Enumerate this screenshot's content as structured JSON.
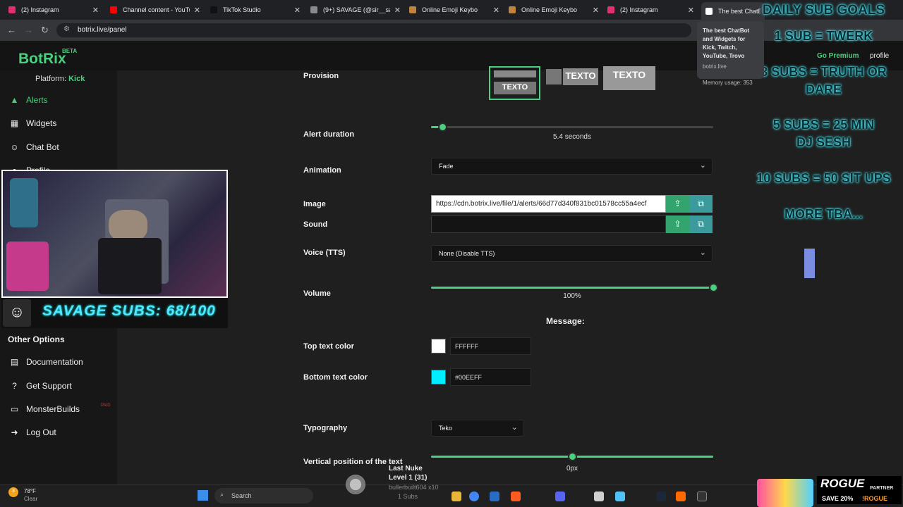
{
  "browser": {
    "tabs": [
      {
        "title": "(2) Instagram",
        "color": "#e1306c"
      },
      {
        "title": "Channel content - YouTube",
        "color": "#ff0000"
      },
      {
        "title": "TikTok Studio",
        "color": "#111111"
      },
      {
        "title": "(9+) SAVAGE (@sir__savag",
        "color": "#8a8a8a"
      },
      {
        "title": "Online Emoji Keybo",
        "color": "#c0843a"
      },
      {
        "title": "Online Emoji Keybo",
        "color": "#c0843a"
      },
      {
        "title": "(2) Instagram",
        "color": "#e1306c"
      },
      {
        "title": "The best ChatBot a",
        "color": "#ffffff"
      }
    ],
    "url": "botrix.live/panel",
    "tooltip": {
      "title": "The best ChatBot and Widgets for Kick, Twitch, YouTube, Trovo",
      "host": "botrix.live",
      "memory": "Memory usage: 353"
    }
  },
  "app": {
    "logo": "BotRix",
    "beta": "BETA",
    "platform_label": "Platform:",
    "platform_value": "Kick",
    "go_premium": "Go Premium",
    "profile": "profile"
  },
  "sidebar": {
    "items": [
      {
        "label": "Alerts",
        "icon": "warning-icon",
        "glyph": "▲"
      },
      {
        "label": "Widgets",
        "icon": "grid-icon",
        "glyph": "▦"
      },
      {
        "label": "Chat Bot",
        "icon": "robot-icon",
        "glyph": "☺"
      },
      {
        "label": "Profile",
        "icon": "user-icon",
        "glyph": "●"
      }
    ],
    "other_title": "Other Options",
    "other_items": [
      {
        "label": "Documentation",
        "icon": "document-icon",
        "glyph": "▤"
      },
      {
        "label": "Get Support",
        "icon": "help-icon",
        "glyph": "?"
      },
      {
        "label": "MonsterBuilds",
        "icon": "monitor-icon",
        "glyph": "▭",
        "badge": "PAID"
      },
      {
        "label": "Log Out",
        "icon": "logout-icon",
        "glyph": "➜"
      }
    ]
  },
  "form": {
    "provision": {
      "label": "Provision",
      "options": [
        "TEXTO",
        "TEXTO",
        "TEXTO"
      ]
    },
    "duration": {
      "label": "Alert duration",
      "value_text": "5.4 seconds",
      "fraction": 0.04
    },
    "animation": {
      "label": "Animation",
      "value": "Fade"
    },
    "image": {
      "label": "Image",
      "value": "https://cdn.botrix.live/file/1/alerts/66d77d340f831bc01578cc55a4ecf"
    },
    "sound": {
      "label": "Sound",
      "value": ""
    },
    "voice": {
      "label": "Voice (TTS)",
      "value": "None (Disable TTS)"
    },
    "volume": {
      "label": "Volume",
      "value_text": "100%",
      "fraction": 1.0
    },
    "message_title": "Message:",
    "top_color": {
      "label": "Top text color",
      "value": "FFFFFF",
      "swatch": "#FFFFFF"
    },
    "bottom_color": {
      "label": "Bottom text color",
      "value": "#00EEFF",
      "swatch": "#00EEFF"
    },
    "typography": {
      "label": "Typography",
      "value": "Teko"
    },
    "vertical": {
      "label": "Vertical position of the text",
      "value_text": "0px",
      "fraction": 0.5
    }
  },
  "overlay": {
    "sub_counter": "SAVAGE SUBS: 68/100",
    "goals": [
      "DAILY SUB GOALS",
      "1 SUB = TWERK",
      "3 SUBS = TRUTH OR DARE",
      "5 SUBS = 25 MIN DJ SESH",
      "10 SUBS = 50 SIT UPS",
      "MORE TBA..."
    ],
    "nuke_title": "Last Nuke",
    "nuke_level": "Level 1  (31)",
    "nuke_user": "bullerbuilt604 x10",
    "nuke_subs": "1 Subs",
    "sponsor_brand": "ROGUE",
    "sponsor_partner": "PARTNER",
    "sponsor_offer": "SAVE 20%",
    "sponsor_code": "!ROGUE"
  },
  "taskbar": {
    "temp": "78°F",
    "weather": "Clear",
    "search": "Search",
    "weather_badge": "3"
  }
}
